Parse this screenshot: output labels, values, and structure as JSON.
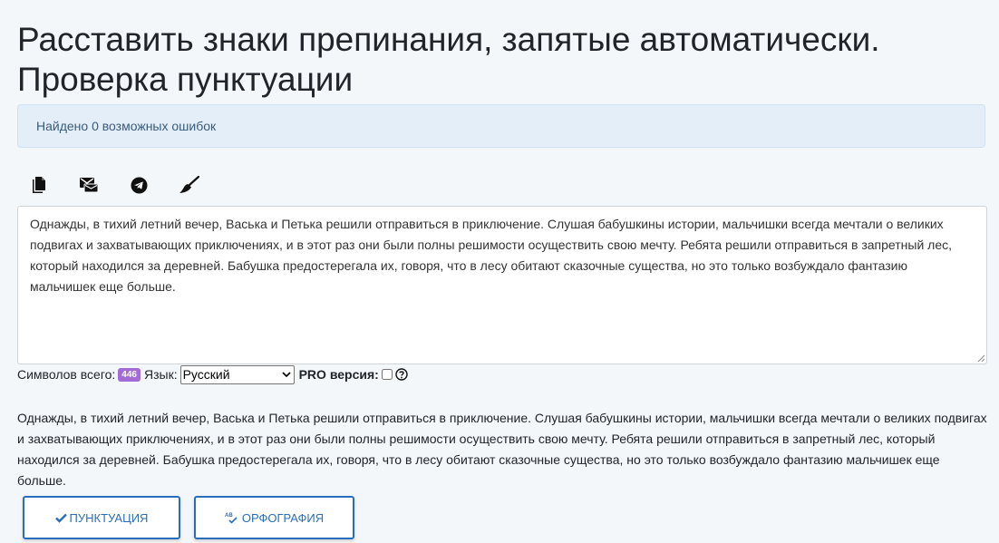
{
  "page": {
    "title": "Расставить знаки препинания, запятые автоматически. Проверка пунктуации"
  },
  "alert": {
    "text": "Найдено 0 возможных ошибок"
  },
  "toolbar": {
    "icons": [
      "copy-icon",
      "mail-icon",
      "telegram-icon",
      "clear-brush-icon"
    ]
  },
  "editor": {
    "text": "Однажды, в тихий летний вечер, Васька и Петька решили отправиться в приключение. Слушая бабушкины истории, мальчишки всегда мечтали о великих подвигах и захватывающих приключениях, и в этот раз они были полны решимости осуществить свою мечту. Ребята решили отправиться в запретный лес, который находился за деревней. Бабушка предостерегала их, говоря, что в лесу обитают сказочные существа, но это только возбуждало фантазию мальчишек еще больше."
  },
  "status": {
    "chars_label": "Символов всего:",
    "chars_count": "446",
    "lang_label": "Язык:",
    "lang_value": "Русский",
    "pro_label": "PRO версия:"
  },
  "result": {
    "text": "Однажды, в тихий летний вечер, Васька и Петька решили отправиться в приключение. Слушая бабушкины истории, мальчишки всегда мечтали о великих подвигах и захватывающих приключениях, и в этот раз они были полны решимости осуществить свою мечту. Ребята решили отправиться в запретный лес, который находился за деревней. Бабушка предостерегала их, говоря, что в лесу обитают сказочные существа, но это только возбуждало фантазию мальчишек еще больше."
  },
  "buttons": {
    "punctuation": "ПУНКТУАЦИЯ",
    "spelling": "ОРФОГРАФИЯ"
  },
  "colors": {
    "accent": "#2a6ebb",
    "badge": "#a36bd6",
    "alert_bg": "#e3eef9"
  }
}
